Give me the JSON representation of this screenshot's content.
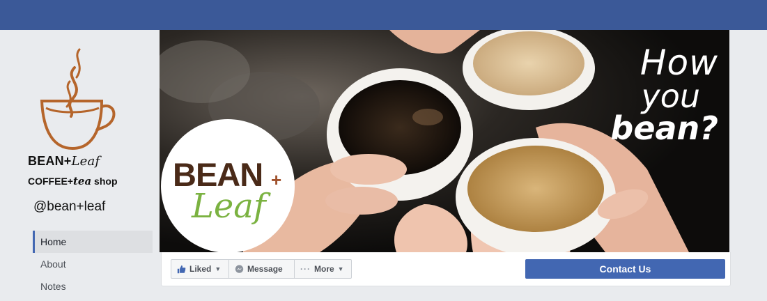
{
  "brand": {
    "name_bold": "BEAN+",
    "name_script": "Leaf",
    "sub_left": "COFFEE+",
    "sub_script": "tea",
    "sub_right": " shop",
    "handle": "@bean+leaf"
  },
  "nav": {
    "items": [
      {
        "label": "Home",
        "active": true
      },
      {
        "label": "About",
        "active": false
      },
      {
        "label": "Notes",
        "active": false
      }
    ]
  },
  "cover": {
    "tagline_1": "How",
    "tagline_2": "you",
    "tagline_3": "bean?"
  },
  "profile_logo": {
    "bean": "BEAN",
    "plus": "+",
    "leaf": "Leaf"
  },
  "actions": {
    "liked": "Liked",
    "message": "Message",
    "more": "More",
    "contact": "Contact Us"
  },
  "colors": {
    "topbar": "#3b5998",
    "accent": "#4267b2",
    "cup_brown": "#b5652b",
    "leaf_green": "#7bb241",
    "bean_brown": "#4a2a18"
  }
}
